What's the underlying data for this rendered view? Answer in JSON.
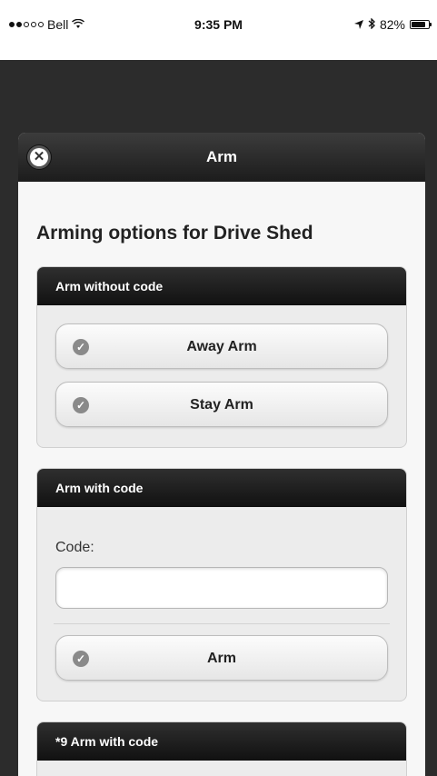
{
  "status_bar": {
    "carrier": "Bell",
    "time": "9:35 PM",
    "battery_text": "82%",
    "battery_level": 0.82,
    "signal_bars_filled": 2,
    "signal_bars_total": 5
  },
  "dialog": {
    "header_title": "Arm",
    "close_icon": "close-icon",
    "title": "Arming options for Drive Shed",
    "sections": {
      "no_code": {
        "header": "Arm without code",
        "buttons": {
          "away": "Away Arm",
          "stay": "Stay Arm"
        }
      },
      "with_code": {
        "header": "Arm with code",
        "code_label": "Code:",
        "code_value": "",
        "arm_button": "Arm"
      },
      "star9": {
        "header": "*9 Arm with code"
      }
    }
  },
  "colors": {
    "header_dark": "#1c1c1c",
    "panel_bg": "#ececec",
    "dialog_bg": "#f7f7f7",
    "icon_gray": "#8a8a8a"
  }
}
